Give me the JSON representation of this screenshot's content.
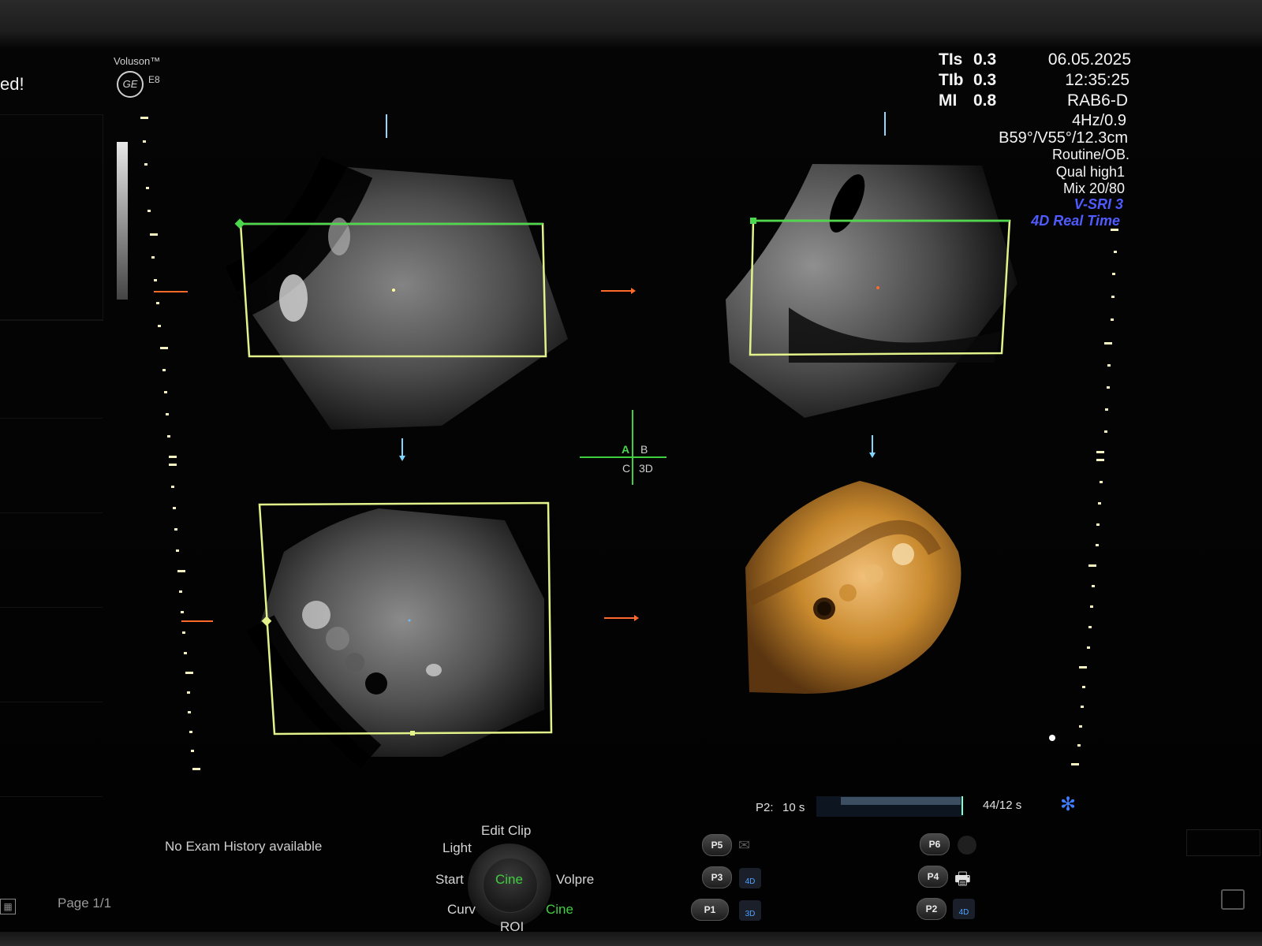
{
  "header": {
    "cut_text": "ed!",
    "brand": "Voluson™",
    "model": "E8",
    "logo": "GE"
  },
  "acq_params": {
    "tis_label": "TIs",
    "tis_value": "0.3",
    "tib_label": "TIb",
    "tib_value": "0.3",
    "mi_label": "MI",
    "mi_value": "0.8",
    "date": "06.05.2025",
    "time": "12:35:25",
    "probe": "RAB6-D",
    "rate": "4Hz/0.9",
    "geometry": "B59°/V55°/12.3cm",
    "preset": "Routine/OB.",
    "quality": "Qual high1",
    "mix": "Mix 20/80",
    "vsri": "V-SRI 3",
    "mode": "4D Real Time"
  },
  "quad": {
    "a": "A",
    "b": "B",
    "c": "C",
    "d": "3D"
  },
  "cine": {
    "label": "P2:",
    "duration": "10 s",
    "progress": 0.98,
    "frames": "44/12 s"
  },
  "footer": {
    "exam_history": "No Exam History available",
    "page": "Page 1/1"
  },
  "softkeys": {
    "edit_clip": "Edit Clip",
    "light": "Light",
    "start": "Start",
    "center": "Cine",
    "volpre": "Volpre",
    "curv": "Curv",
    "cine": "Cine",
    "roi": "ROI"
  },
  "presets": {
    "p5": "P5",
    "p3": "P3",
    "p1": "P1",
    "p6": "P6",
    "p4": "P4",
    "p2": "P2",
    "tag_4d": "4D",
    "tag_3d": "3D",
    "tag_4d_b": "4D"
  },
  "colors": {
    "roi_box": "#e3f28a",
    "roi_top": "#4cd84c",
    "marker": "#ff6a2a",
    "arrow_blue": "#7fd6ff",
    "render": "#c98a2e",
    "accent_blue": "#4f5bff"
  },
  "icons": [
    "ge-logo-icon",
    "settings-gear-icon",
    "grid-icon",
    "mail-icon",
    "printer-icon",
    "4d-volume-icon",
    "3d-volume-icon",
    "monitor-icon"
  ]
}
